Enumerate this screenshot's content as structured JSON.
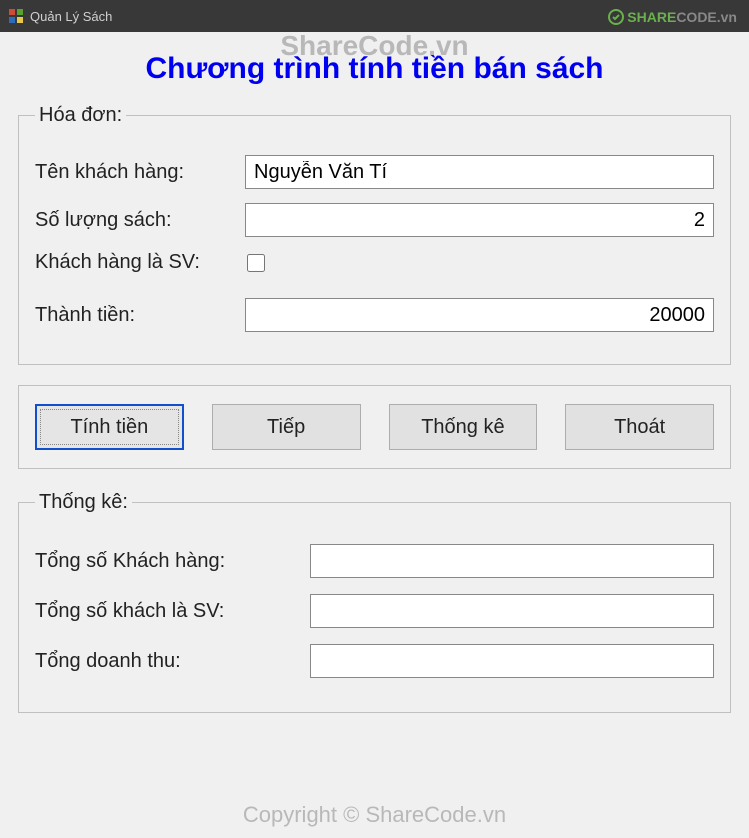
{
  "window": {
    "title": "Quản Lý Sách"
  },
  "watermarks": {
    "top": "ShareCode.vn",
    "logo_prefix": "SHARE",
    "logo_suffix": "CODE.vn",
    "bottom": "Copyright © ShareCode.vn"
  },
  "main_title": "Chương trình tính tiền bán sách",
  "invoice": {
    "legend": "Hóa đơn:",
    "customer_label": "Tên khách hàng:",
    "customer_value": "Nguyễn Văn Tí",
    "qty_label": "Số lượng sách:",
    "qty_value": "2",
    "sv_label": "Khách hàng là SV:",
    "sv_checked": false,
    "total_label": "Thành tiền:",
    "total_value": "20000"
  },
  "buttons": {
    "calc": "Tính tiền",
    "next": "Tiếp",
    "stats": "Thống kê",
    "exit": "Thoát"
  },
  "stats": {
    "legend": "Thống kê:",
    "total_customers_label": "Tổng số Khách hàng:",
    "total_customers_value": "",
    "total_sv_label": "Tổng số khách là SV:",
    "total_sv_value": "",
    "revenue_label": "Tổng doanh thu:",
    "revenue_value": ""
  }
}
